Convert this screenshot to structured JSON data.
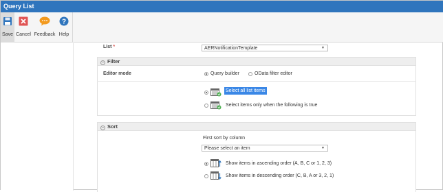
{
  "window": {
    "title": "Query List"
  },
  "toolbar": {
    "save_label": "Save",
    "cancel_label": "Cancel",
    "feedback_label": "Feedback",
    "help_label": "Help"
  },
  "list_field": {
    "label": "List",
    "required_mark": "*",
    "value": "AERNotificationTemplate"
  },
  "filter": {
    "title": "Filter",
    "editor_mode_label": "Editor mode",
    "modes": [
      {
        "label": "Query builder",
        "selected": true
      },
      {
        "label": "OData filter editor",
        "selected": false
      }
    ],
    "options": [
      {
        "label": "Select all list items",
        "selected": true
      },
      {
        "label": "Select items only when the following is true",
        "selected": false
      }
    ]
  },
  "sort": {
    "title": "Sort",
    "first_sort_label": "First sort by column",
    "column_placeholder": "Please select an item",
    "options": [
      {
        "label": "Show items in ascending order (A, B, C or 1, 2, 3)",
        "selected": true
      },
      {
        "label": "Show items in descending order (C, B, A or 3, 2, 1)",
        "selected": false
      }
    ]
  },
  "colors": {
    "titlebar": "#2f75bd",
    "highlight": "#3a87e6",
    "cancel": "#e05555",
    "feedback": "#f39a1e",
    "help": "#2f75bd"
  }
}
